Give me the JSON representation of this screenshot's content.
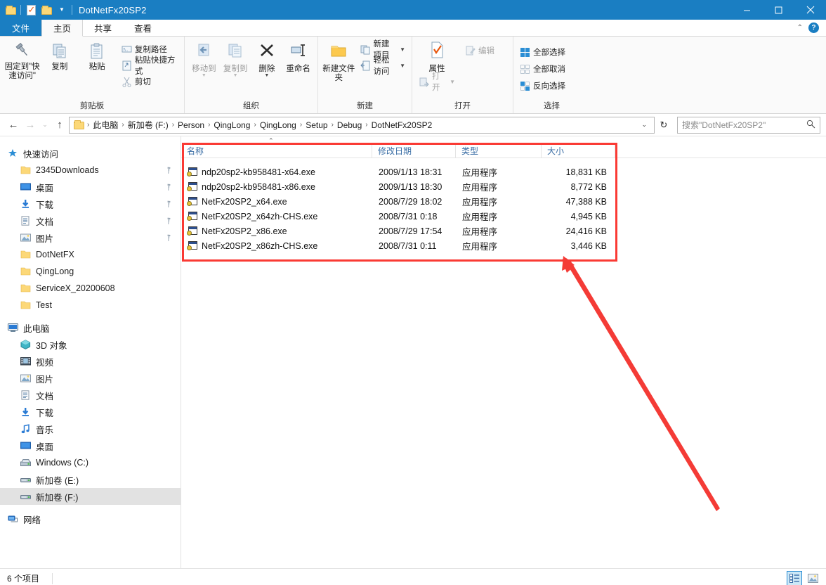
{
  "window": {
    "title": "DotNetFx20SP2",
    "quick_access": [
      {
        "name": "folder-icon",
        "label": ""
      },
      {
        "name": "properties-icon",
        "label": ""
      },
      {
        "name": "new-folder-icon",
        "label": ""
      },
      {
        "name": "customize-qat-caret",
        "label": "▼"
      }
    ],
    "controls": {
      "minimize": "—",
      "maximize": "□",
      "close": "✕"
    }
  },
  "ribbon": {
    "tabs": [
      {
        "label": "文件",
        "type": "file"
      },
      {
        "label": "主页",
        "type": "active"
      },
      {
        "label": "共享",
        "type": "normal"
      },
      {
        "label": "查看",
        "type": "normal"
      }
    ],
    "collapse_label": "⌃",
    "help_label": "?",
    "groups": [
      {
        "title": "剪贴板",
        "big": [
          {
            "label": "固定到\"快速访问\"",
            "icon": "pin-icon",
            "disabled": false
          },
          {
            "label": "复制",
            "icon": "copy-icon",
            "disabled": false
          },
          {
            "label": "粘贴",
            "icon": "paste-icon",
            "disabled": false
          }
        ],
        "small": [
          {
            "label": "复制路径",
            "icon": "copy-path-icon"
          },
          {
            "label": "粘贴快捷方式",
            "icon": "paste-shortcut-icon"
          },
          {
            "label": "剪切",
            "icon": "cut-icon"
          }
        ]
      },
      {
        "title": "组织",
        "big": [
          {
            "label": "移动到",
            "icon": "move-to-icon",
            "caret": true,
            "disabled": true
          },
          {
            "label": "复制到",
            "icon": "copy-to-icon",
            "caret": true,
            "disabled": true
          },
          {
            "label": "删除",
            "icon": "delete-icon",
            "caret": true,
            "disabled": false
          },
          {
            "label": "重命名",
            "icon": "rename-icon",
            "caret": false,
            "disabled": false
          }
        ]
      },
      {
        "title": "新建",
        "big": [
          {
            "label": "新建文件夹",
            "icon": "new-folder-icon",
            "disabled": false
          }
        ],
        "small": [
          {
            "label": "新建项目",
            "icon": "new-item-icon",
            "caret": true
          },
          {
            "label": "轻松访问",
            "icon": "easy-access-icon",
            "caret": true
          }
        ]
      },
      {
        "title": "打开",
        "big": [
          {
            "label": "属性",
            "icon": "properties-icon",
            "disabled": false
          }
        ],
        "small": [
          {
            "label": "编辑",
            "icon": "edit-icon",
            "disabled": true
          },
          {
            "label": "打开",
            "icon": "open-icon",
            "caret": true,
            "disabled": true
          }
        ]
      },
      {
        "title": "选择",
        "small": [
          {
            "label": "全部选择",
            "icon": "select-all-icon"
          },
          {
            "label": "全部取消",
            "icon": "select-none-icon"
          },
          {
            "label": "反向选择",
            "icon": "invert-selection-icon"
          }
        ]
      }
    ]
  },
  "address": {
    "back_icon": "back-arrow-icon",
    "forward_icon": "forward-arrow-icon",
    "recent_icon": "recent-locations-icon",
    "up_icon": "up-arrow-icon",
    "breadcrumbs": [
      "此电脑",
      "新加卷 (F:)",
      "Person",
      "QingLong",
      "QingLong",
      "Setup",
      "Debug",
      "DotNetFx20SP2"
    ],
    "separator": "›",
    "dropdown_caret": "⌄",
    "refresh_icon": "refresh-icon",
    "search_placeholder": "搜索\"DotNetFx20SP2\"",
    "search_value": "",
    "search_icon": "search-icon"
  },
  "sidebar": {
    "groups": [
      {
        "header": {
          "label": "快速访问",
          "icon": "star-pin-icon"
        },
        "items": [
          {
            "label": "2345Downloads",
            "icon": "folder-icon",
            "pinned": true
          },
          {
            "label": "桌面",
            "icon": "desktop-icon",
            "pinned": true
          },
          {
            "label": "下载",
            "icon": "downloads-icon",
            "pinned": true
          },
          {
            "label": "文档",
            "icon": "documents-icon",
            "pinned": true
          },
          {
            "label": "图片",
            "icon": "pictures-icon",
            "pinned": true
          },
          {
            "label": "DotNetFX",
            "icon": "folder-icon",
            "pinned": false
          },
          {
            "label": "QingLong",
            "icon": "folder-icon",
            "pinned": false
          },
          {
            "label": "ServiceX_20200608",
            "icon": "folder-icon",
            "pinned": false
          },
          {
            "label": "Test",
            "icon": "folder-icon",
            "pinned": false
          }
        ]
      },
      {
        "header": {
          "label": "此电脑",
          "icon": "this-pc-icon"
        },
        "items": [
          {
            "label": "3D 对象",
            "icon": "3d-objects-icon",
            "pinned": false
          },
          {
            "label": "视频",
            "icon": "videos-icon",
            "pinned": false
          },
          {
            "label": "图片",
            "icon": "pictures-icon",
            "pinned": false
          },
          {
            "label": "文档",
            "icon": "documents-icon",
            "pinned": false
          },
          {
            "label": "下载",
            "icon": "downloads-icon",
            "pinned": false
          },
          {
            "label": "音乐",
            "icon": "music-icon",
            "pinned": false
          },
          {
            "label": "桌面",
            "icon": "desktop-icon",
            "pinned": false
          },
          {
            "label": "Windows (C:)",
            "icon": "system-drive-icon",
            "pinned": false
          },
          {
            "label": "新加卷 (E:)",
            "icon": "drive-icon",
            "pinned": false
          },
          {
            "label": "新加卷 (F:)",
            "icon": "drive-icon",
            "pinned": false,
            "selected": true
          }
        ]
      },
      {
        "header": {
          "label": "网络",
          "icon": "network-icon"
        },
        "items": []
      }
    ]
  },
  "filelist": {
    "sort_indicator": "⌃",
    "columns": [
      {
        "key": "name",
        "label": "名称"
      },
      {
        "key": "date",
        "label": "修改日期"
      },
      {
        "key": "type",
        "label": "类型"
      },
      {
        "key": "size",
        "label": "大小"
      }
    ],
    "rows": [
      {
        "icon": "exe-icon",
        "name": "ndp20sp2-kb958481-x64.exe",
        "date": "2009/1/13 18:31",
        "type": "应用程序",
        "size": "18,831 KB"
      },
      {
        "icon": "exe-icon",
        "name": "ndp20sp2-kb958481-x86.exe",
        "date": "2009/1/13 18:30",
        "type": "应用程序",
        "size": "8,772 KB"
      },
      {
        "icon": "exe-icon",
        "name": "NetFx20SP2_x64.exe",
        "date": "2008/7/29 18:02",
        "type": "应用程序",
        "size": "47,388 KB"
      },
      {
        "icon": "exe-icon",
        "name": "NetFx20SP2_x64zh-CHS.exe",
        "date": "2008/7/31 0:18",
        "type": "应用程序",
        "size": "4,945 KB"
      },
      {
        "icon": "exe-icon",
        "name": "NetFx20SP2_x86.exe",
        "date": "2008/7/29 17:54",
        "type": "应用程序",
        "size": "24,416 KB"
      },
      {
        "icon": "exe-icon",
        "name": "NetFx20SP2_x86zh-CHS.exe",
        "date": "2008/7/31 0:11",
        "type": "应用程序",
        "size": "3,446 KB"
      }
    ]
  },
  "status": {
    "item_count": "6 个项目",
    "views": [
      {
        "name": "details-view",
        "selected": true
      },
      {
        "name": "large-icons-view",
        "selected": false
      }
    ]
  },
  "annotation": {
    "box_color": "#fa3a34",
    "arrow_color": "#f43b36"
  }
}
